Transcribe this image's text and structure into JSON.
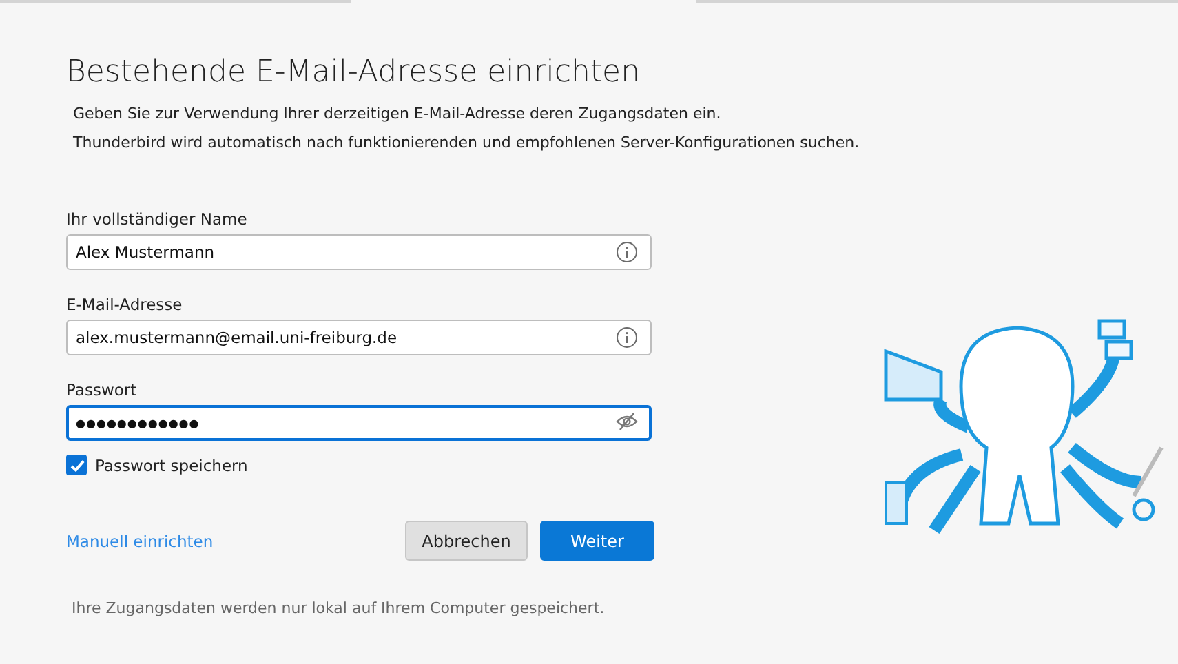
{
  "title": "Bestehende E-Mail-Adresse einrichten",
  "intro": [
    "Geben Sie zur Verwendung Ihrer derzeitigen E-Mail-Adresse deren Zugangsdaten ein.",
    "Thunderbird wird automatisch nach funktionierenden und empfohlenen Server-Konfigurationen suchen."
  ],
  "fields": [
    {
      "label": "Ihr vollständiger Name",
      "value": "Alex Mustermann",
      "kind": "text",
      "focused": false
    },
    {
      "label": "E-Mail-Adresse",
      "value": "alex.mustermann@email.uni-freiburg.de",
      "kind": "text",
      "focused": false
    },
    {
      "label": "Passwort",
      "value": "●●●●●●●●●●●●",
      "kind": "password",
      "focused": true
    }
  ],
  "save_password": {
    "label": "Passwort speichern",
    "checked": true
  },
  "manual_link": "Manuell einrichten",
  "buttons": [
    {
      "label": "Abbrechen",
      "kind": "secondary"
    },
    {
      "label": "Weiter",
      "kind": "primary"
    }
  ],
  "footer": "Ihre Zugangsdaten werden nur lokal auf Ihrem Computer gespeichert."
}
